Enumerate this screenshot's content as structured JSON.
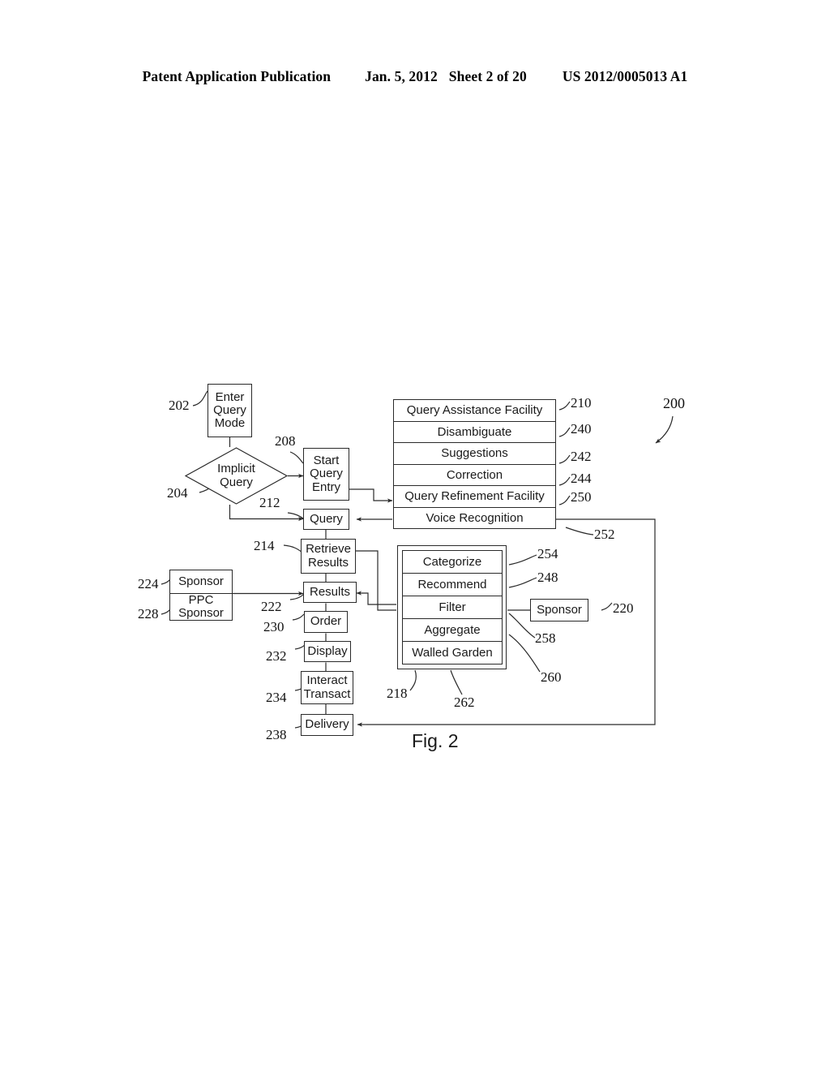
{
  "header": {
    "publication": "Patent Application Publication",
    "date": "Jan. 5, 2012",
    "sheet": "Sheet 2 of 20",
    "number": "US 2012/0005013 A1"
  },
  "figure": {
    "label": "Fig. 2",
    "system_ref": "200"
  },
  "nodes": {
    "enter_query_mode": {
      "line1": "Enter",
      "line2": "Query",
      "line3": "Mode",
      "ref": "202"
    },
    "implicit_query": {
      "line1": "Implicit",
      "line2": "Query",
      "ref": "204"
    },
    "start_query_entry": {
      "line1": "Start",
      "line2": "Query",
      "line3": "Entry",
      "ref": "208"
    },
    "query": {
      "line1": "Query",
      "ref": "212"
    },
    "retrieve_results": {
      "line1": "Retrieve",
      "line2": "Results",
      "ref": "214"
    },
    "results": {
      "line1": "Results",
      "ref": "222"
    },
    "order": {
      "line1": "Order",
      "ref": "230"
    },
    "display": {
      "line1": "Display",
      "ref": "232"
    },
    "interact_transact": {
      "line1": "Interact",
      "line2": "Transact",
      "ref": "234"
    },
    "delivery": {
      "line1": "Delivery",
      "ref": "238"
    },
    "sponsor_left": {
      "line1": "Sponsor",
      "ref": "224"
    },
    "ppc_sponsor": {
      "line1": "PPC",
      "line2": "Sponsor",
      "ref": "228"
    },
    "sponsor_right": {
      "line1": "Sponsor",
      "ref": "220"
    }
  },
  "query_facility_stack": {
    "rows": [
      {
        "label": "Query Assistance Facility",
        "ref": "210"
      },
      {
        "label": "Disambiguate",
        "ref": "240"
      },
      {
        "label": "Suggestions",
        "ref": "242"
      },
      {
        "label": "Correction",
        "ref": "244"
      },
      {
        "label": "Query Refinement Facility",
        "ref": "250"
      },
      {
        "label": "Voice Recognition",
        "ref": "252"
      }
    ]
  },
  "results_processing_stack": {
    "outer_ref": "218",
    "rows": [
      {
        "label": "Categorize",
        "ref": "254"
      },
      {
        "label": "Recommend",
        "ref": "248"
      },
      {
        "label": "Filter",
        "ref": "258"
      },
      {
        "label": "Aggregate",
        "ref": "260"
      },
      {
        "label": "Walled Garden",
        "ref": "262"
      }
    ]
  },
  "colors": {
    "line": "#2a2a2a",
    "text": "#1a1a1a",
    "background": "#ffffff"
  }
}
